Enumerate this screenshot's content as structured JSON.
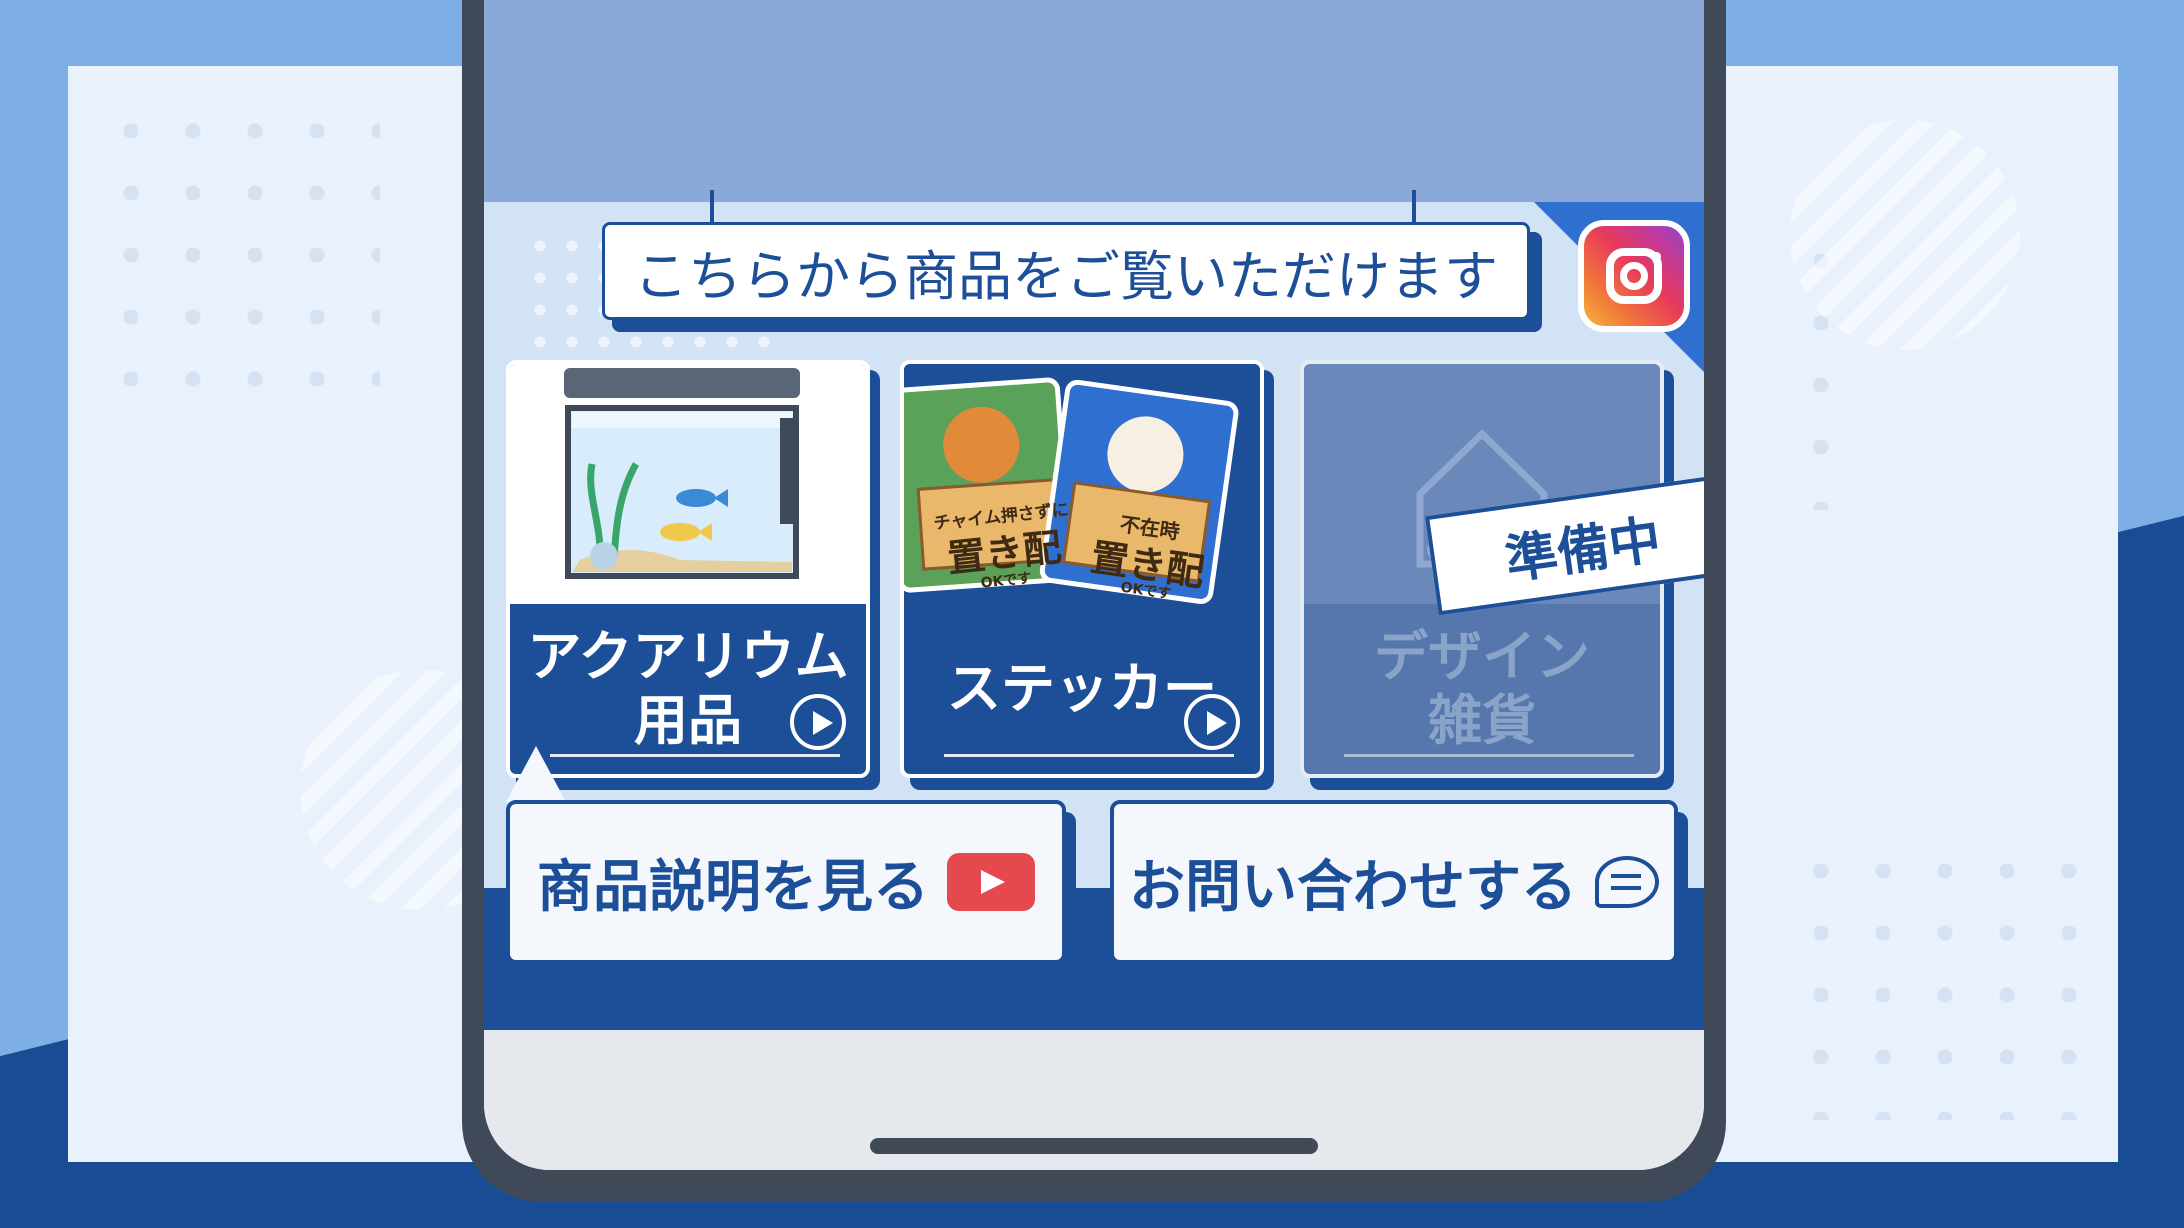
{
  "header": {
    "banner_text": "こちらから商品をご覧いただけます",
    "instagram_icon": "instagram-icon"
  },
  "cards": [
    {
      "label": "アクアリウム\n用品",
      "icon": "aquarium-tank-icon",
      "status": "active"
    },
    {
      "label": "ステッカー",
      "icon": "sticker-icon",
      "status": "active",
      "sticker_texts": [
        "チャイム押さずに",
        "置き配",
        "OKです",
        "不在時",
        "置き配",
        "OKです"
      ]
    },
    {
      "label": "デザイン\n雑貨",
      "icon": "house-fish-icon",
      "status": "disabled",
      "badge": "準備中"
    }
  ],
  "buttons": {
    "product_info": "商品説明を見る",
    "product_info_icon": "youtube-play-icon",
    "contact": "お問い合わせする",
    "contact_icon": "chat-bubble-icon"
  },
  "colors": {
    "primary": "#1c4f98",
    "background_light": "#7eaee6",
    "youtube_red": "#e5484d",
    "warning_cone": "#f2b93a"
  }
}
